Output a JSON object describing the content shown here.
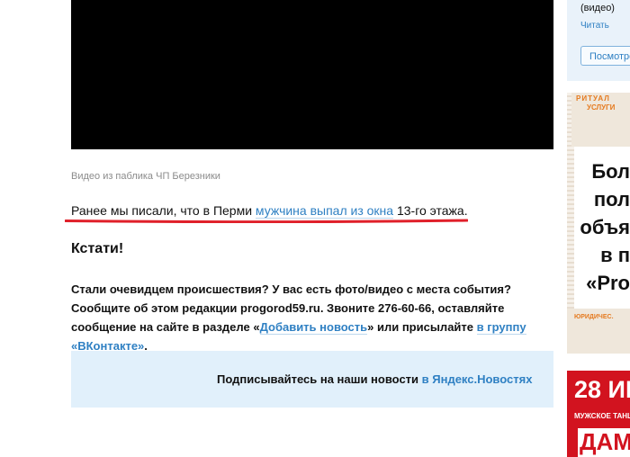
{
  "article": {
    "video_caption": "Видео из паблика ЧП Березники",
    "para1": {
      "before": "Ранее мы писали, что в Перми ",
      "link": "мужчина выпал из окна",
      "after": " 13-го этажа."
    },
    "heading": "Кстати!",
    "para2": {
      "text1": "Стали очевидцем происшествия? У вас есть фото/видео с места события? Сообщите об этом редакции progorod59.ru. Звоните 276-60-66, оставляйте сообщение на сайте в разделе «",
      "link1": "Добавить новость",
      "text2": "» или присылайте ",
      "link2": "в группу «ВКонтакте»",
      "text3": "."
    },
    "subscribe": {
      "text": "Подписывайтесь на наши новости ",
      "link": "в Яндекс.Новостях"
    }
  },
  "sidebar": {
    "video_tag": "(видео)",
    "read_link": "Читать",
    "watch_button": "Посмотреть"
  },
  "ads": {
    "ad1": {
      "header_top": "РИТУАЛ",
      "header_bottom": "УСЛУГИ",
      "lines": [
        "Бол",
        "пол",
        "объя",
        "в п",
        "«Pro"
      ],
      "bottom_label": "ЮРИДИЧЕС."
    },
    "ad2": {
      "big": "28 ИН",
      "small": "МУЖСКОЕ ТАНЦ",
      "banner": "ДАМ"
    }
  },
  "colors": {
    "link": "#2f80c3",
    "underline_annotation": "#e0202a",
    "subscribe_bg": "#e1f0fb",
    "ad2_bg": "#d2131f"
  }
}
